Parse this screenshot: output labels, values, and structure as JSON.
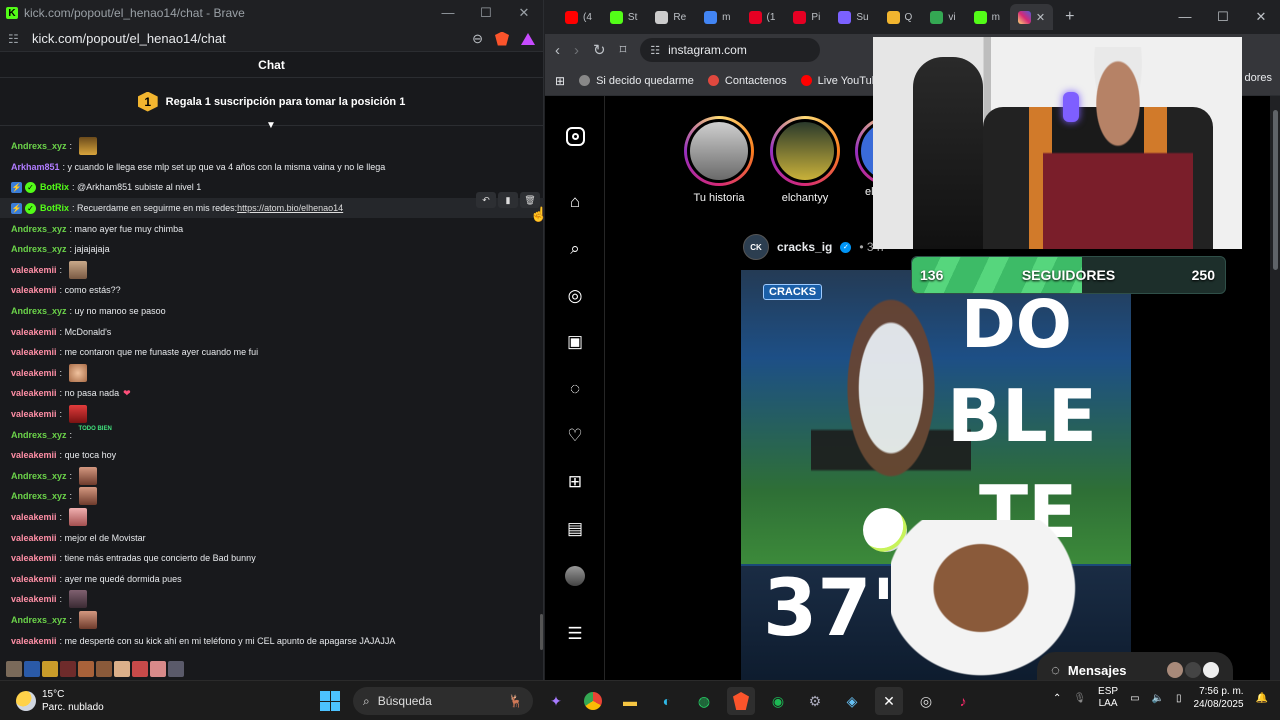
{
  "left_window": {
    "title": "kick.com/popout/el_henao14/chat - Brave",
    "url": "kick.com/popout/el_henao14/chat",
    "chat_header": "Chat",
    "pinned_rank": "1",
    "pinned_text": "Regala 1 suscripción para tomar la posición 1",
    "messages": [
      {
        "user": "Andrexs_xyz",
        "text": "",
        "color": "green",
        "emote": "em-hat"
      },
      {
        "user": "Arkham851",
        "text": "y cuando le llega ese mlp set up que va 4 años con la misma vaina y no le llega",
        "color": "purple"
      },
      {
        "user": "BotRix",
        "text": "@Arkham851 subiste al nivel 1",
        "color": "bot",
        "bot": true
      },
      {
        "user": "BotRix",
        "text": "Recuerdame en seguirme en mis redes: ",
        "link": "https://atom.bio/elhenao14",
        "color": "bot",
        "bot": true,
        "highlight": true
      },
      {
        "user": "Andrexs_xyz",
        "text": "mano ayer fue muy chimba",
        "color": "green"
      },
      {
        "user": "Andrexs_xyz",
        "text": "jajajajaja",
        "color": "green"
      },
      {
        "user": "valeakemii",
        "text": "",
        "color": "pink",
        "emote": "em-cat"
      },
      {
        "user": "valeakemii",
        "text": "como estás??",
        "color": "pink"
      },
      {
        "user": "Andrexs_xyz",
        "text": "uy no manoo se pasoo",
        "color": "green"
      },
      {
        "user": "valeakemii",
        "text": "McDonald's",
        "color": "pink"
      },
      {
        "user": "valeakemii",
        "text": "me contaron que me funaste ayer cuando me fui",
        "color": "pink"
      },
      {
        "user": "valeakemii",
        "text": "",
        "color": "pink",
        "emote": "em-face"
      },
      {
        "user": "valeakemii",
        "text": "no pasa nada",
        "color": "pink",
        "heart": "❤"
      },
      {
        "user": "valeakemii",
        "text": "",
        "color": "pink",
        "emote": "em-red"
      },
      {
        "user": "Andrexs_xyz",
        "text": "",
        "color": "green",
        "emote": "em-todo",
        "emote_text": "TODO BIEN"
      },
      {
        "user": "valeakemii",
        "text": "que toca hoy",
        "color": "pink"
      },
      {
        "user": "Andrexs_xyz",
        "text": "",
        "color": "green",
        "emote": "em-sketch"
      },
      {
        "user": "Andrexs_xyz",
        "text": "",
        "color": "green",
        "emote": "em-sketch"
      },
      {
        "user": "valeakemii",
        "text": "",
        "color": "pink",
        "emote": "em-pink"
      },
      {
        "user": "valeakemii",
        "text": "mejor el de Movistar",
        "color": "pink"
      },
      {
        "user": "valeakemii",
        "text": "tiene más entradas que concierto de Bad bunny",
        "color": "pink"
      },
      {
        "user": "valeakemii",
        "text": "ayer me quedé dormida pues",
        "color": "pink"
      },
      {
        "user": "valeakemii",
        "text": "",
        "color": "pink",
        "emote": "em-dark"
      },
      {
        "user": "Andrexs_xyz",
        "text": "",
        "color": "green",
        "emote": "em-sketch"
      },
      {
        "user": "valeakemii",
        "text": "me desperté con su kick ahí en mi teléfono y mi CEL apunto de apagarse JAJAJJA",
        "color": "pink"
      }
    ]
  },
  "right_window": {
    "tabs": [
      {
        "label": "(4",
        "icon": "youtube-icon",
        "color": "#ff0000"
      },
      {
        "label": "St",
        "icon": "kick-icon",
        "color": "#53fc18"
      },
      {
        "label": "Re",
        "icon": "chatgpt-icon",
        "color": "#cccccc"
      },
      {
        "label": "m",
        "icon": "google-icon",
        "color": "#4285f4"
      },
      {
        "label": "(1",
        "icon": "pinterest-icon",
        "color": "#e60023"
      },
      {
        "label": "Pi",
        "icon": "pinterest-icon",
        "color": "#e60023"
      },
      {
        "label": "Su",
        "icon": "app-icon",
        "color": "#7b61ff"
      },
      {
        "label": "Q",
        "icon": "app-icon",
        "color": "#f2b52f"
      },
      {
        "label": "vi",
        "icon": "drive-icon",
        "color": "#34a853"
      },
      {
        "label": "m",
        "icon": "kick-icon",
        "color": "#53fc18"
      }
    ],
    "url": "instagram.com",
    "bookmarks": [
      {
        "label": "Si decido quedarme",
        "color": "#888888"
      },
      {
        "label": "Contactenos",
        "color": "#e0483e"
      },
      {
        "label": "Live YouTub",
        "color": "#ff0000"
      }
    ],
    "bookmarks_right": "dores",
    "stories": [
      {
        "label": "Tu historia"
      },
      {
        "label": "elchantyy"
      },
      {
        "label": "el"
      }
    ],
    "post": {
      "avatar_text": "CK",
      "user": "cracks_ig",
      "time": "• 3 h",
      "brand": "CRACKS",
      "headline_1": "DO",
      "headline_2": "BLE",
      "headline_3": "TE",
      "bottom_text": "37'"
    },
    "messages_label": "Mensajes"
  },
  "overlay": {
    "followers_current": "136",
    "followers_label": "SEGUIDORES",
    "followers_goal": "250",
    "progress": 0.544
  },
  "taskbar": {
    "temp": "15°C",
    "weather": "Parc. nublado",
    "search": "Búsqueda",
    "lang1": "ESP",
    "lang2": "LAA",
    "time": "7:56 p. m.",
    "date": "24/08/2025"
  }
}
